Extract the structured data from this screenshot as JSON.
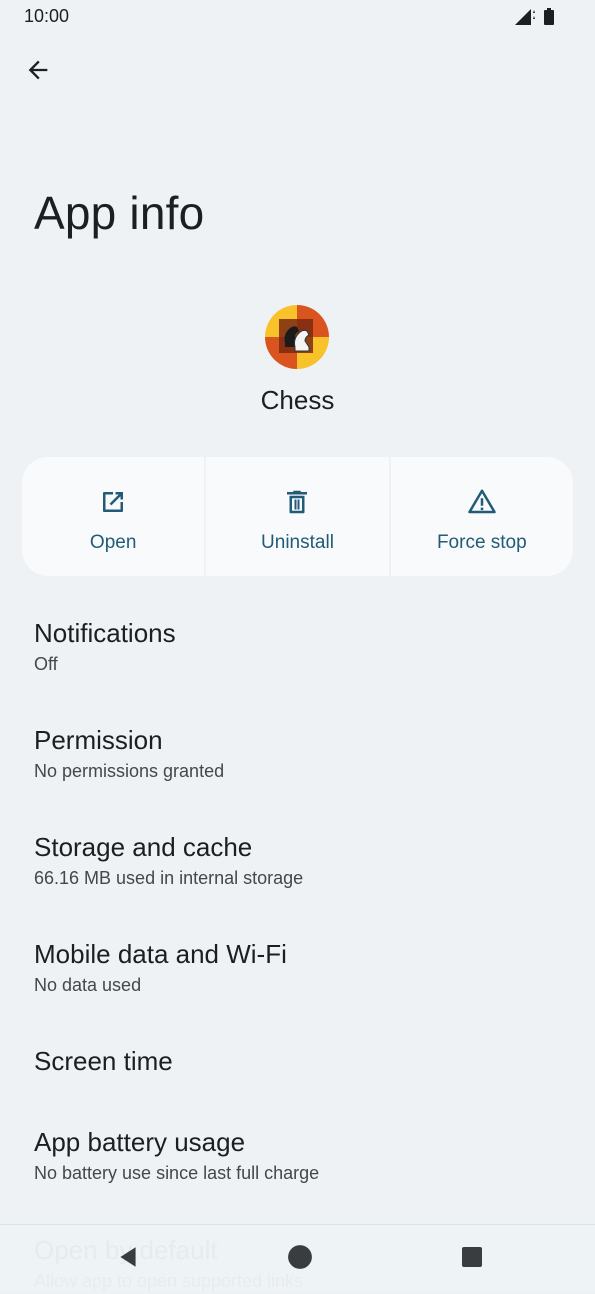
{
  "status_bar": {
    "time": "10:00",
    "signal_icon": "signal-icon",
    "battery_icon": "battery-icon"
  },
  "header": {
    "back_icon": "arrow-back-icon",
    "title": "App info"
  },
  "app": {
    "icon": "chess-app-icon",
    "name": "Chess"
  },
  "actions": [
    {
      "label": "Open",
      "icon": "open-external-icon"
    },
    {
      "label": "Uninstall",
      "icon": "trash-icon"
    },
    {
      "label": "Force stop",
      "icon": "warning-icon"
    }
  ],
  "settings": [
    {
      "title": "Notifications",
      "summary": "Off"
    },
    {
      "title": "Permission",
      "summary": "No permissions granted"
    },
    {
      "title": "Storage and cache",
      "summary": "66.16 MB used in internal storage"
    },
    {
      "title": "Mobile data and Wi-Fi",
      "summary": "No data used"
    },
    {
      "title": "Screen time",
      "summary": ""
    },
    {
      "title": "App battery usage",
      "summary": "No battery use since last full charge"
    },
    {
      "title": "Open by default",
      "summary": "Allow app to open supported links"
    }
  ],
  "nav_bar": {
    "back": "nav-back-icon",
    "home": "nav-home-icon",
    "recents": "nav-recents-icon"
  },
  "colors": {
    "background": "#eef2f5",
    "card": "#f8fafc",
    "accent": "#235b77"
  }
}
